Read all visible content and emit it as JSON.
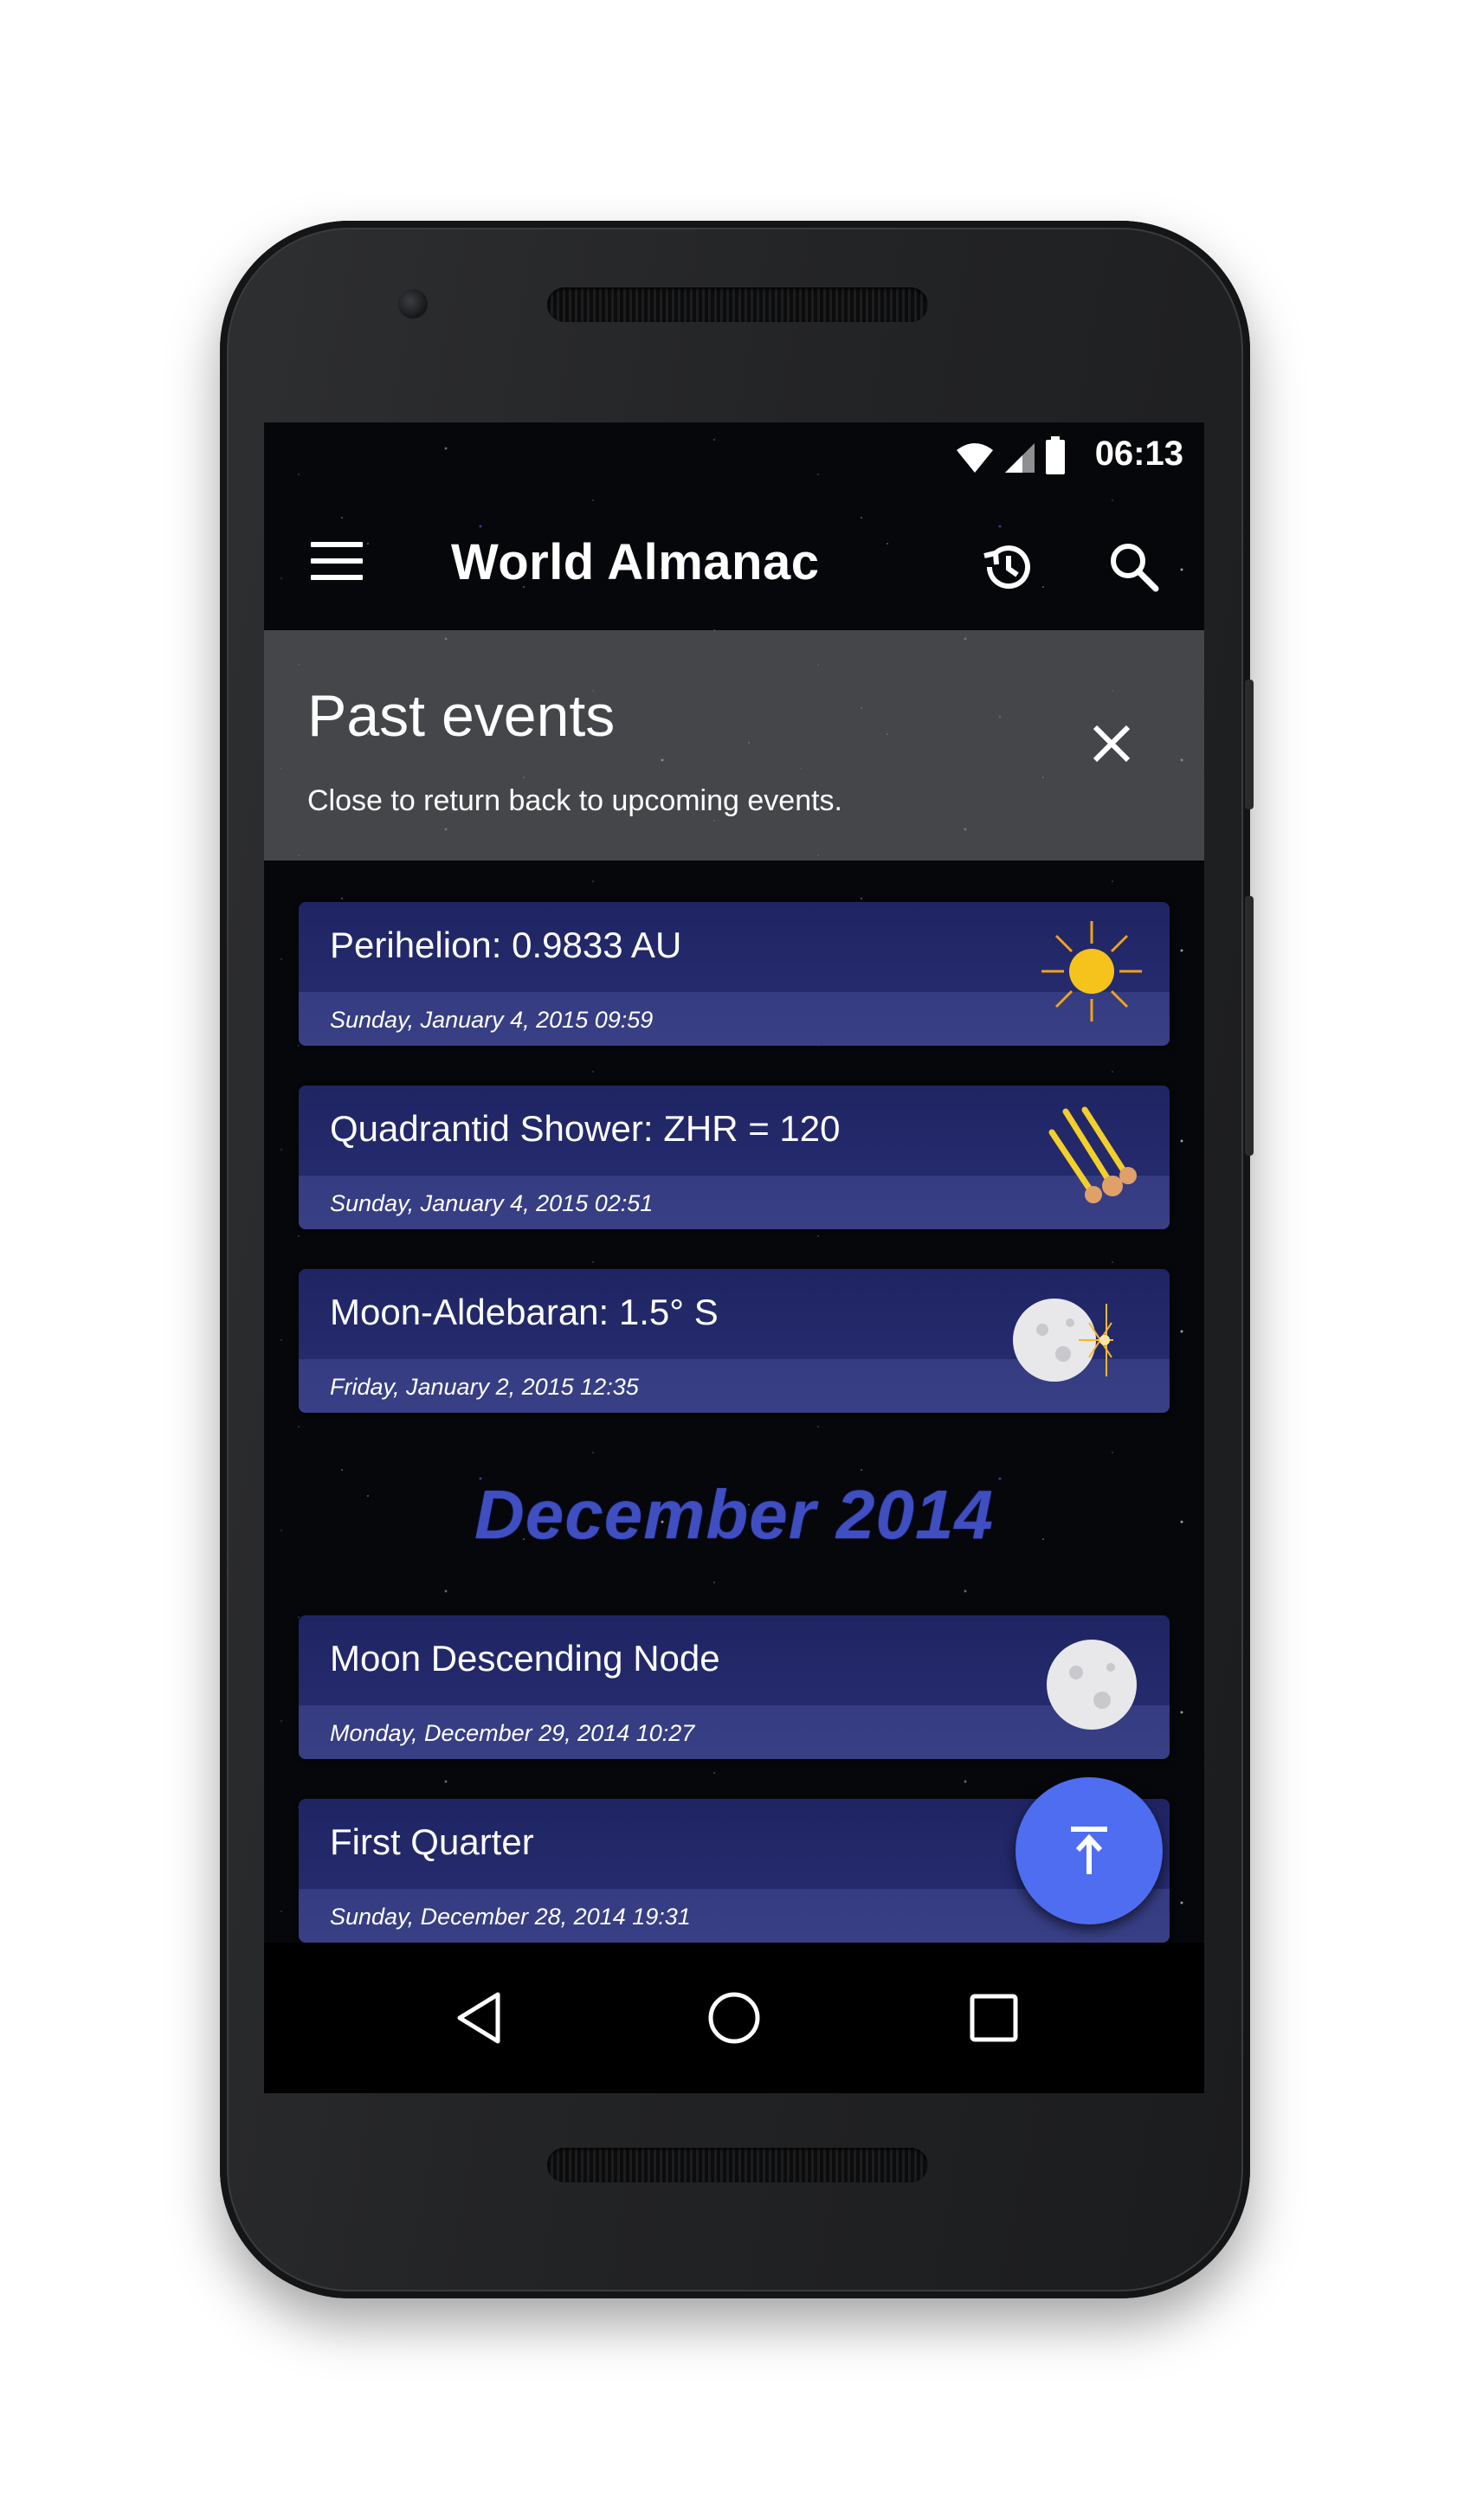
{
  "status_bar": {
    "time": "06:13",
    "icons": [
      "wifi-icon",
      "signal-icon",
      "battery-icon"
    ]
  },
  "app_bar": {
    "title": "World Almanac",
    "icons": [
      "menu-icon",
      "history-icon",
      "search-icon"
    ]
  },
  "banner": {
    "title": "Past events",
    "subtitle": "Close to return back to upcoming events.",
    "close_icon": "close-icon"
  },
  "events": [
    {
      "title": "Perihelion: 0.9833 AU",
      "date": "Sunday, January 4, 2015 09:59",
      "icon": "sun-icon"
    },
    {
      "title": "Quadrantid Shower: ZHR = 120",
      "date": "Sunday, January 4, 2015 02:51",
      "icon": "meteor-shower-icon"
    },
    {
      "title": "Moon-Aldebaran: 1.5° S",
      "date": "Friday, January 2, 2015 12:35",
      "icon": "moon-star-icon"
    }
  ],
  "month_header": "December 2014",
  "events_december": [
    {
      "title": "Moon Descending Node",
      "date": "Monday, December 29, 2014 10:27",
      "icon": "moon-icon"
    },
    {
      "title": "First Quarter",
      "date": "Sunday, December 28, 2014 19:31",
      "icon": "first-quarter-icon"
    }
  ],
  "fab": {
    "icon": "scroll-to-top-icon"
  },
  "nav_bar": {
    "icons": [
      "back-icon",
      "home-icon",
      "recents-icon"
    ]
  },
  "colors": {
    "card": "#242a6c",
    "accent": "#4f6df0",
    "month_header": "#3f4ec0"
  }
}
